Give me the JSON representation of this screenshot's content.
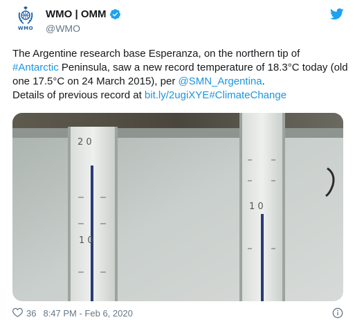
{
  "tweet": {
    "author": {
      "display_name": "WMO | OMM",
      "handle": "@WMO",
      "avatar_caption": "WMO",
      "verified_icon": "verified-badge-icon"
    },
    "platform_icon": "twitter-bird-icon",
    "text": {
      "part1": "The Argentine research base Esperanza, on the northern tip of ",
      "hashtag1": "#Antarctic",
      "part2": " Peninsula, saw a new record temperature of 18.3°C today (old one 17.5°C on 24 March 2015), per ",
      "mention": "@SMN_Argentina",
      "part3": ".\n Details of previous record at ",
      "url": "bit.ly/2ugiXYE",
      "hashtag2": "#ClimateChange"
    },
    "media": {
      "thermometer_left": {
        "scale_top": "2 0",
        "scale_bottom": "1 0"
      },
      "thermometer_right": {
        "scale": "1 0"
      }
    },
    "footer": {
      "likes": "36",
      "timestamp": "8:47 PM - Feb 6, 2020",
      "heart_icon": "heart-icon",
      "info_icon": "info-icon"
    },
    "colors": {
      "link": "#1b95e0",
      "twitter_blue": "#1da1f2",
      "muted": "#657786"
    }
  }
}
